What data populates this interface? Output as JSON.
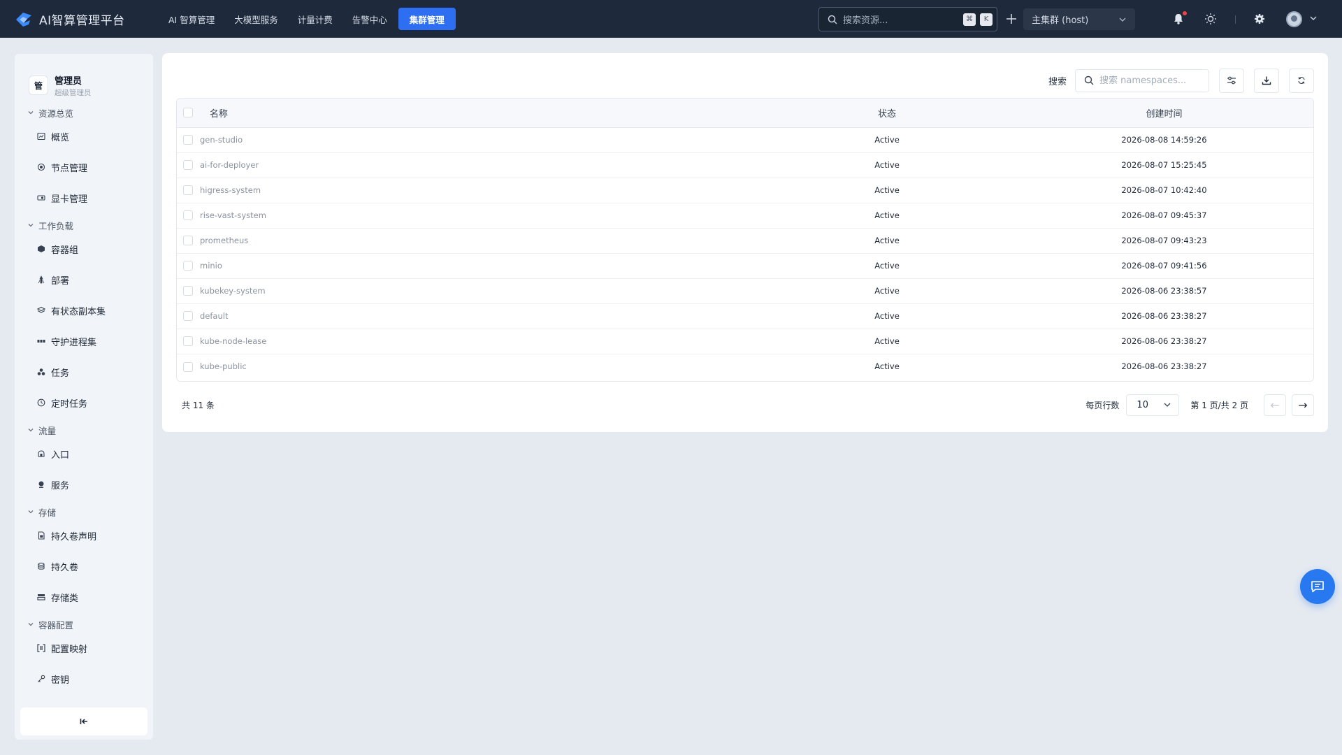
{
  "app": {
    "title": "AI智算管理平台",
    "logo_icon": "brand-logo-icon"
  },
  "nav": {
    "items": [
      "AI 智算管理",
      "大模型服务",
      "计量计费",
      "告警中心"
    ],
    "active": "集群管理"
  },
  "global_search": {
    "placeholder": "搜索资源...",
    "kbd1": "⌘",
    "kbd2": "K"
  },
  "cluster": {
    "value": "主集群 (host)"
  },
  "user": {
    "avatar_char": "管",
    "name": "管理员",
    "role": "超级管理员"
  },
  "sidebar": {
    "groups": [
      {
        "label": "资源总览",
        "items": [
          {
            "label": "概览",
            "icon": "dashboard-icon"
          },
          {
            "label": "节点管理",
            "icon": "node-icon"
          },
          {
            "label": "显卡管理",
            "icon": "gpu-icon"
          }
        ]
      },
      {
        "label": "工作负载",
        "items": [
          {
            "label": "容器组",
            "icon": "pod-icon"
          },
          {
            "label": "部署",
            "icon": "deploy-icon"
          },
          {
            "label": "有状态副本集",
            "icon": "layers-icon"
          },
          {
            "label": "守护进程集",
            "icon": "daemonset-icon"
          },
          {
            "label": "任务",
            "icon": "job-icon"
          },
          {
            "label": "定时任务",
            "icon": "clock-icon"
          }
        ]
      },
      {
        "label": "流量",
        "items": [
          {
            "label": "入口",
            "icon": "ingress-icon"
          },
          {
            "label": "服务",
            "icon": "service-icon"
          }
        ]
      },
      {
        "label": "存储",
        "items": [
          {
            "label": "持久卷声明",
            "icon": "pvc-icon"
          },
          {
            "label": "持久卷",
            "icon": "database-icon"
          },
          {
            "label": "存储类",
            "icon": "storageclass-icon"
          }
        ]
      },
      {
        "label": "容器配置",
        "items": [
          {
            "label": "配置映射",
            "icon": "configmap-icon"
          },
          {
            "label": "密钥",
            "icon": "key-icon"
          }
        ]
      }
    ]
  },
  "toolbar": {
    "search_label": "搜索",
    "search_placeholder": "搜索 namespaces..."
  },
  "table": {
    "columns": {
      "name": "名称",
      "status": "状态",
      "created": "创建时间"
    },
    "rows": [
      {
        "name": "gen-studio",
        "status": "Active",
        "created": "2026-08-08 14:59:26"
      },
      {
        "name": "ai-for-deployer",
        "status": "Active",
        "created": "2026-08-07 15:25:45"
      },
      {
        "name": "higress-system",
        "status": "Active",
        "created": "2026-08-07 10:42:40"
      },
      {
        "name": "rise-vast-system",
        "status": "Active",
        "created": "2026-08-07 09:45:37"
      },
      {
        "name": "prometheus",
        "status": "Active",
        "created": "2026-08-07 09:43:23"
      },
      {
        "name": "minio",
        "status": "Active",
        "created": "2026-08-07 09:41:56"
      },
      {
        "name": "kubekey-system",
        "status": "Active",
        "created": "2026-08-06 23:38:57"
      },
      {
        "name": "default",
        "status": "Active",
        "created": "2026-08-06 23:38:27"
      },
      {
        "name": "kube-node-lease",
        "status": "Active",
        "created": "2026-08-06 23:38:27"
      },
      {
        "name": "kube-public",
        "status": "Active",
        "created": "2026-08-06 23:38:27"
      }
    ]
  },
  "pagination": {
    "total": "共 11 条",
    "per_page_label": "每页行数",
    "per_page": "10",
    "page_info": "第 1 页/共 2 页",
    "prev": "←",
    "next": "→"
  },
  "colors": {
    "topbar": "#1e2a3b",
    "accent": "#2d6ff0",
    "fab": "#2878f0",
    "notify": "#ef4444"
  }
}
